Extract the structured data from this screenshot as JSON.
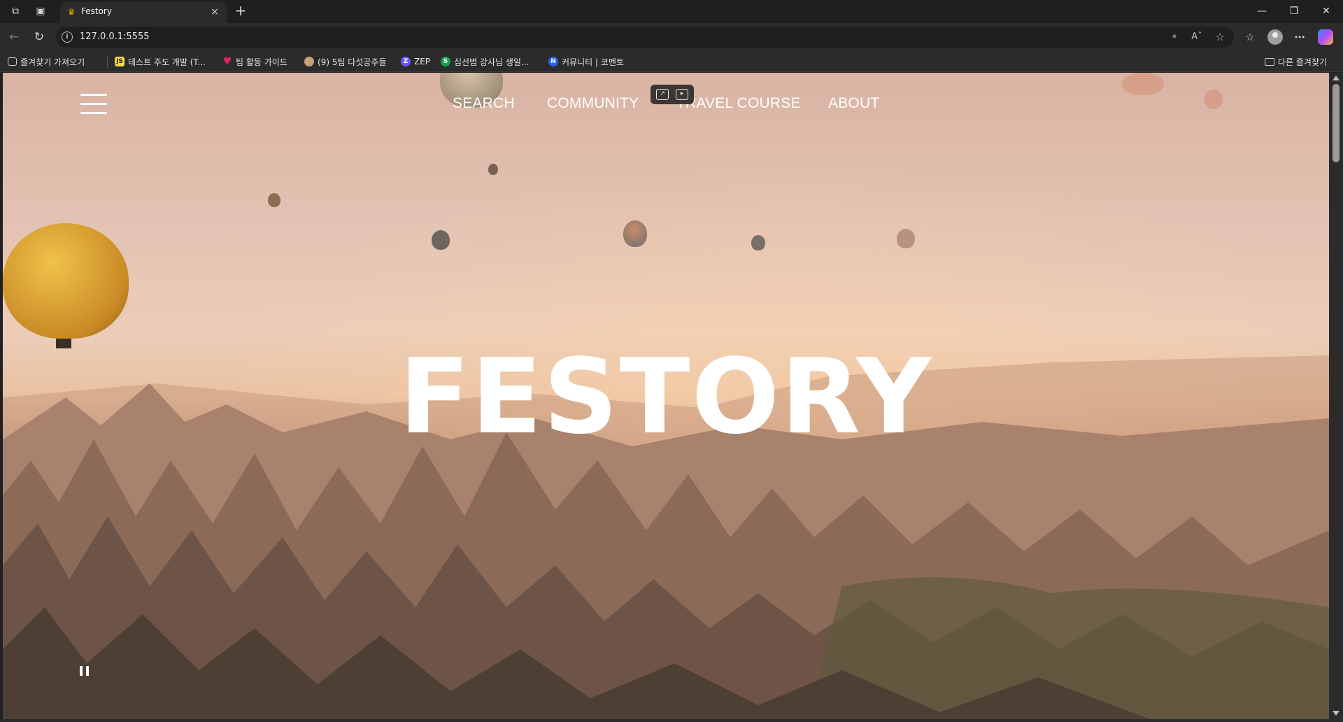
{
  "browser": {
    "tab_title": "Festory",
    "url": "127.0.0.1:5555",
    "new_tab_symbol": "+",
    "close_symbol": "×"
  },
  "bookmarks": {
    "items": [
      {
        "label": "즐겨찾기 가져오기",
        "icon": "import-icon"
      },
      {
        "label": "테스트 주도 개발 (T...",
        "icon": "js-icon",
        "icon_text": "JS",
        "color": "#f0db4f"
      },
      {
        "label": "팀 활동 가이드",
        "icon": "heart-icon",
        "color": "#e0245e"
      },
      {
        "label": "(9) 5팀 다섯공주들",
        "icon": "avatar-icon"
      },
      {
        "label": "ZEP",
        "icon": "zep-icon",
        "icon_text": "Z",
        "color": "#6758ff"
      },
      {
        "label": "심선범 강사님 생일...",
        "icon": "s-icon",
        "icon_text": "S",
        "color": "#16a34a"
      },
      {
        "label": "커뮤니티 | 코멘토",
        "icon": "comento-icon",
        "icon_text": "N",
        "color": "#2563eb"
      }
    ],
    "other_favorites": "다른 즐겨찾기"
  },
  "page": {
    "nav": {
      "search": "SEARCH",
      "community": "COMMUNITY",
      "travel_course": "TRAVEL COURSE",
      "about": "ABOUT"
    },
    "hero_title": "FESTORY"
  },
  "colors": {
    "chrome_dark": "#1f1f1f",
    "chrome_toolbar": "#2b2b2b",
    "text_white": "#ffffff"
  }
}
